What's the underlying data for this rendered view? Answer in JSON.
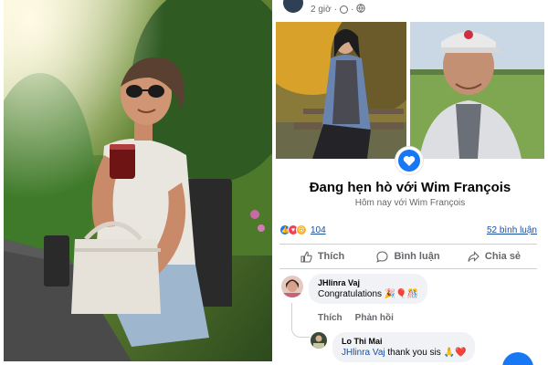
{
  "post": {
    "time": "2 giờ",
    "more_label": "•••",
    "event_title": "Đang hẹn hò với Wim François",
    "event_subtitle": "Hôm nay với Wim François",
    "reaction_count": "104",
    "comment_count": "52 bình luận"
  },
  "actions": {
    "like": "Thích",
    "comment": "Bình luận",
    "share": "Chia sẻ"
  },
  "comments": [
    {
      "author": "JHlinra Vaj",
      "text": "Congratulations",
      "emojis": "🎉🎈🎊",
      "reply_like": "Thích",
      "reply_reply": "Phản hồi"
    },
    {
      "author": "Lo Thi Mai",
      "tag": "JHlinra Vaj",
      "text": " thank you sis",
      "emojis": "🙏❤️"
    }
  ],
  "colors": {
    "facebook_blue": "#1877f2",
    "link_blue": "#1a4fa0",
    "muted_gray": "#65676b",
    "bubble_gray": "#f0f2f5"
  },
  "icons": [
    "globe-icon",
    "heart-icon",
    "like-icon",
    "love-icon",
    "wow-icon",
    "thumbs-up-icon",
    "comment-icon",
    "share-icon"
  ]
}
